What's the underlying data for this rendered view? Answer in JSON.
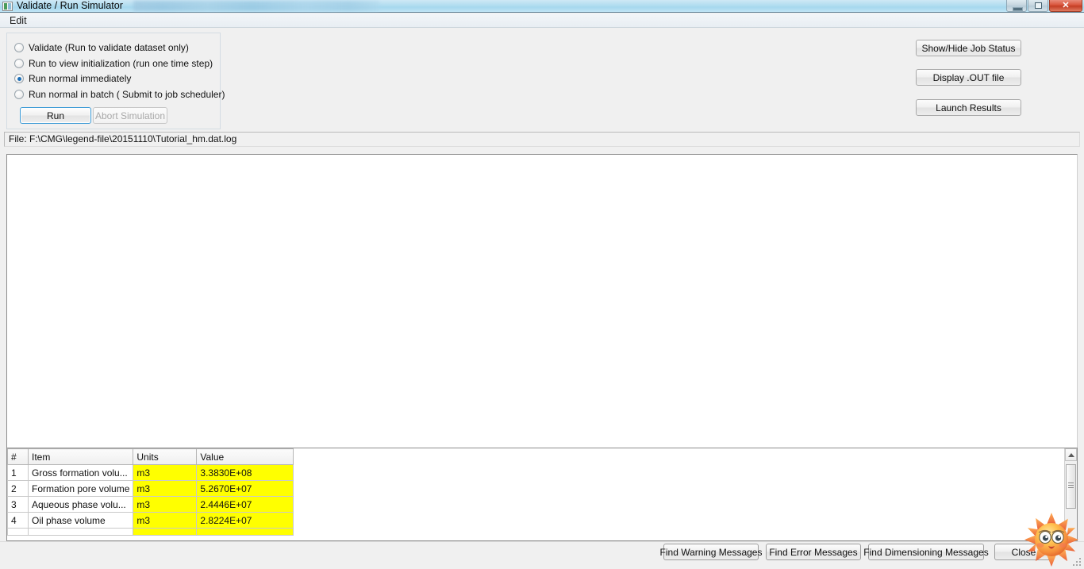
{
  "window": {
    "title": "Validate / Run Simulator",
    "icon": "app-icon",
    "controls": {
      "minimize": "—",
      "restore": "❐",
      "close": "✕"
    }
  },
  "menubar": {
    "items": [
      {
        "label": "Edit"
      }
    ]
  },
  "run_options": {
    "options": [
      {
        "label": "Validate (Run to validate dataset only)",
        "selected": false
      },
      {
        "label": "Run to view initialization (run one time step)",
        "selected": false
      },
      {
        "label": "Run normal immediately",
        "selected": true
      },
      {
        "label": "Run normal  in batch ( Submit to job scheduler)",
        "selected": false
      }
    ],
    "run_button": "Run",
    "abort_button": "Abort Simulation",
    "abort_disabled": true
  },
  "side_buttons": [
    {
      "label": "Show/Hide Job Status"
    },
    {
      "label": "Display .OUT file"
    },
    {
      "label": "Launch Results"
    }
  ],
  "file_label": "File: F:\\CMG\\legend-file\\20151110\\Tutorial_hm.dat.log",
  "log_area": {
    "content": "",
    "placeholder": ""
  },
  "table": {
    "headers": [
      "#",
      "Item",
      "Units",
      "Value"
    ],
    "rows": [
      {
        "num": "1",
        "item": "Gross formation volu...",
        "units": "m3",
        "value": "3.3830E+08"
      },
      {
        "num": "2",
        "item": "Formation pore volume",
        "units": "m3",
        "value": "5.2670E+07"
      },
      {
        "num": "3",
        "item": "Aqueous phase volu...",
        "units": "m3",
        "value": "2.4446E+07"
      },
      {
        "num": "4",
        "item": "Oil phase volume",
        "units": "m3",
        "value": "2.8224E+07"
      },
      {
        "num": "",
        "item": "",
        "units": "",
        "value": ""
      }
    ],
    "highlight_color": "#ffff00"
  },
  "bottom_buttons": [
    {
      "label": "Find Warning Messages"
    },
    {
      "label": "Find Error Messages"
    },
    {
      "label": "Find Dimensioning Messages"
    },
    {
      "label": "Close"
    }
  ],
  "colors": {
    "titlebar": "#b2ddf0",
    "surface": "#f0f0f0",
    "accent": "#3c9bd6",
    "highlight": "#ffff00"
  }
}
